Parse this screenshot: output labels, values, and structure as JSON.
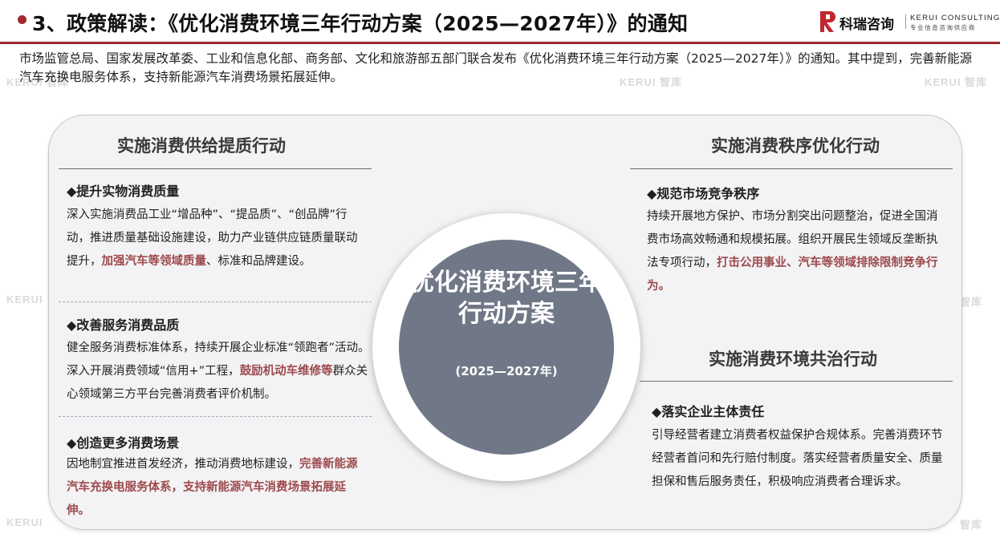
{
  "header": {
    "title": "3、政策解读：《优化消费环境三年行动方案（2025—2027年）》的通知",
    "logo_cn": "科瑞咨询",
    "logo_en": "KERUI CONSULTING",
    "logo_en_sub": "专业信息咨询供应商",
    "accent_color": "#9e2a2f"
  },
  "intro": "市场监管总局、国家发展改革委、工业和信息化部、商务部、文化和旅游部五部门联合发布《优化消费环境三年行动方案（2025—2027年）》的通知。其中提到，完善新能源汽车充换电服务体系，支持新能源汽车消费场景拓展延伸。",
  "watermark": {
    "brand": "KERUI",
    "cn": "智库"
  },
  "center": {
    "title": "优化消费环境三年行动方案",
    "subtitle": "(2025—2027年)"
  },
  "left": {
    "heading": "实施消费供给提质行动",
    "items": [
      {
        "title": "◆提升实物消费质量",
        "text_a": "深入实施消费品工业“增品种”、“提品质”、“创品牌”行动，推进质量基础设施建设，助力产业链供应链质量联动提升，",
        "text_hl": "加强汽车等领域质量",
        "text_b": "、标准和品牌建设。"
      },
      {
        "title": "◆改善服务消费品质",
        "text_a": "健全服务消费标准体系，持续开展企业标准“领跑者”活动。深入开展消费领域“信用+”工程，",
        "text_hl": "鼓励机动车维修等",
        "text_b": "群众关心领域第三方平台完善消费者评价机制。"
      },
      {
        "title": "◆创造更多消费场景",
        "text_a": "因地制宜推进首发经济，推动消费地标建设，",
        "text_hl": "完善新能源汽车充换电服务体系，支持新能源汽车消费场景拓展延伸。",
        "text_b": ""
      }
    ]
  },
  "right_top": {
    "heading": "实施消费秩序优化行动",
    "item": {
      "title": "◆规范市场竞争秩序",
      "text_a": "持续开展地方保护、市场分割突出问题整治，促进全国消费市场高效畅通和规模拓展。组织开展民生领域反垄断执法专项行动，",
      "text_hl": "打击公用事业、汽车等领域排除限制竞争行为。",
      "text_b": ""
    }
  },
  "right_bottom": {
    "heading": "实施消费环境共治行动",
    "item": {
      "title": "◆落实企业主体责任",
      "text_a": "引导经营者建立消费者权益保护合规体系。完善消费环节经营者首问和先行赔付制度。落实经营者质量安全、质量担保和售后服务责任，积极响应消费者合理诉求。",
      "text_hl": "",
      "text_b": ""
    }
  }
}
